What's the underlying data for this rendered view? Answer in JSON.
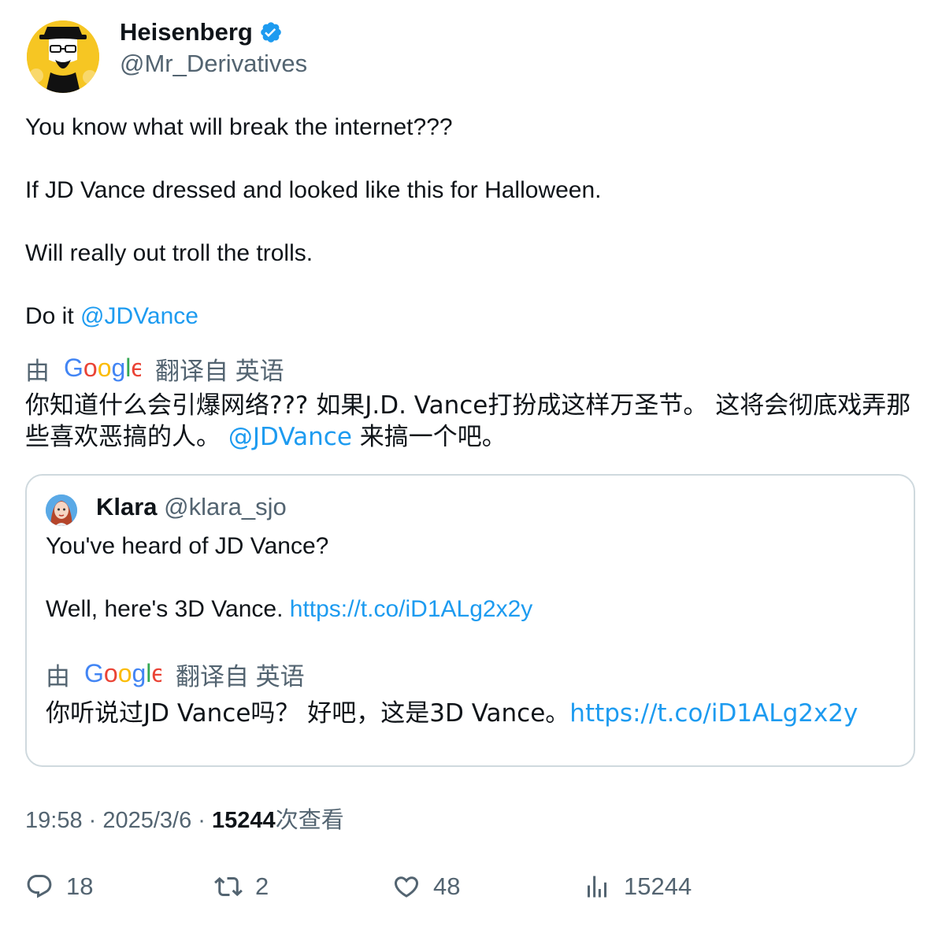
{
  "author": {
    "name": "Heisenberg",
    "handle": "@Mr_Derivatives",
    "verified": true
  },
  "tweet": {
    "line1": "You know what will break the internet???",
    "line2": "If JD Vance dressed and looked like this for Halloween.",
    "line3": "Will really out troll the trolls.",
    "line4_prefix": "Do it ",
    "line4_mention": "@JDVance"
  },
  "translation": {
    "by": "由",
    "provider": "Google",
    "label": "翻译自 英语",
    "text_part1": "你知道什么会引爆网络??? 如果J.D. Vance打扮成这样万圣节。 这将会彻底戏弄那些喜欢恶搞的人。 ",
    "text_mention": "@JDVance",
    "text_part2": " 来搞一个吧。"
  },
  "quote": {
    "name": "Klara",
    "handle": "@klara_sjo",
    "line1": "You've heard of JD Vance?",
    "line2_prefix": "Well, here's 3D Vance. ",
    "line2_link": "https://t.co/iD1ALg2x2y",
    "translation": {
      "by": "由",
      "provider": "Google",
      "label": "翻译自 英语",
      "text_prefix": "你听说过JD Vance吗？ 好吧，这是3D Vance。",
      "text_link": "https://t.co/iD1ALg2x2y"
    }
  },
  "meta": {
    "time": "19:58",
    "sep1": " · ",
    "date": "2025/3/6",
    "sep2": " · ",
    "views": "15244",
    "views_label": "次查看"
  },
  "actions": {
    "replies": "18",
    "retweets": "2",
    "likes": "48",
    "views": "15244"
  },
  "colors": {
    "link": "#1d9bf0",
    "secondary_text": "#536471",
    "primary_text": "#0f1419",
    "border": "#cfd9de"
  },
  "icons": [
    "verified-badge-icon",
    "google-logo",
    "reply-icon",
    "retweet-icon",
    "like-icon",
    "views-icon"
  ]
}
